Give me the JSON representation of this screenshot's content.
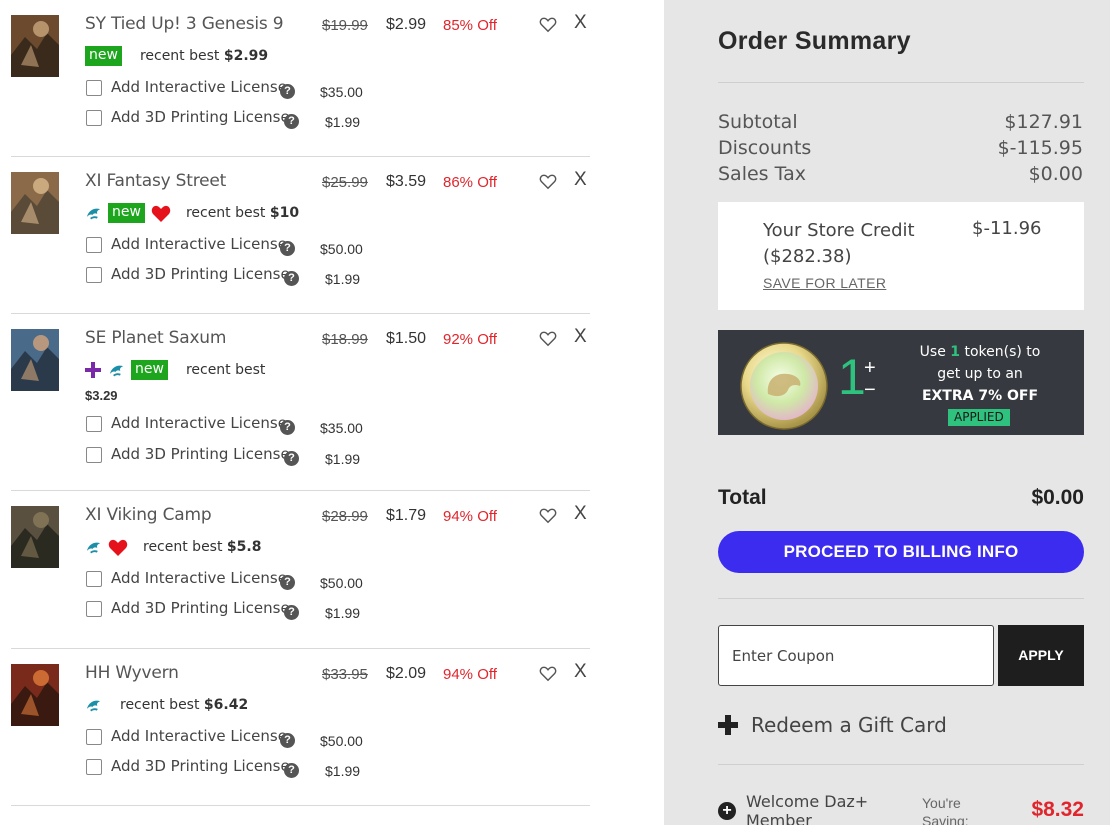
{
  "items": [
    {
      "name": "SY Tied Up! 3 Genesis 9",
      "old_price": "$19.99",
      "new_price": "$2.99",
      "discount": "85% Off",
      "badges": [
        "new"
      ],
      "recent_label": "recent best",
      "recent_value": "$2.99",
      "licenses": [
        {
          "label": "Add Interactive License",
          "price": "$35.00"
        },
        {
          "label": "Add 3D Printing License",
          "price": "$1.99"
        }
      ]
    },
    {
      "name": "XI Fantasy Street",
      "old_price": "$25.99",
      "new_price": "$3.59",
      "discount": "86% Off",
      "badges": [
        "dolphin-icon",
        "new",
        "heart-icon"
      ],
      "recent_label": "recent best",
      "recent_value": "$10",
      "licenses": [
        {
          "label": "Add Interactive License",
          "price": "$50.00"
        },
        {
          "label": "Add 3D Printing License",
          "price": "$1.99"
        }
      ]
    },
    {
      "name": "SE Planet Saxum",
      "old_price": "$18.99",
      "new_price": "$1.50",
      "discount": "92% Off",
      "badges": [
        "plus-icon",
        "dolphin-icon",
        "new"
      ],
      "recent_label": "recent best",
      "recent_value": "$3.29",
      "licenses": [
        {
          "label": "Add Interactive License",
          "price": "$35.00"
        },
        {
          "label": "Add 3D Printing License",
          "price": "$1.99"
        }
      ]
    },
    {
      "name": "XI Viking Camp",
      "old_price": "$28.99",
      "new_price": "$1.79",
      "discount": "94% Off",
      "badges": [
        "dolphin-icon",
        "heart-icon"
      ],
      "recent_label": "recent best",
      "recent_value": "$5.8",
      "licenses": [
        {
          "label": "Add Interactive License",
          "price": "$50.00"
        },
        {
          "label": "Add 3D Printing License",
          "price": "$1.99"
        }
      ]
    },
    {
      "name": "HH Wyvern",
      "old_price": "$33.95",
      "new_price": "$2.09",
      "discount": "94% Off",
      "badges": [
        "dolphin-icon"
      ],
      "recent_label": "recent best",
      "recent_value": "$6.42",
      "licenses": [
        {
          "label": "Add Interactive License",
          "price": "$50.00"
        },
        {
          "label": "Add 3D Printing License",
          "price": "$1.99"
        }
      ]
    }
  ],
  "remove_label": "X",
  "help_label": "?",
  "summary": {
    "title": "Order Summary",
    "subtotal_label": "Subtotal",
    "subtotal_value": "$127.91",
    "discounts_label": "Discounts",
    "discounts_value": "$-115.95",
    "tax_label": "Sales Tax",
    "tax_value": "$0.00",
    "credit_label": "Your Store Credit ($282.38)",
    "credit_value": "$-11.96",
    "save_later": "SAVE FOR LATER",
    "token_count": "1",
    "token_plus": "+",
    "token_minus": "−",
    "token_text_pre": "Use",
    "token_text_num": "1",
    "token_text_post": "token(s) to get up to an",
    "token_extra": "EXTRA 7% OFF",
    "token_applied": "APPLIED",
    "total_label": "Total",
    "total_value": "$0.00",
    "proceed_label": "PROCEED TO BILLING INFO",
    "coupon_placeholder": "Enter Coupon",
    "apply_label": "APPLY",
    "gift_label": "Redeem a Gift Card",
    "member_label": "Welcome Daz+ Member",
    "saving_label": "You're Saving:",
    "saving_value": "$8.32"
  },
  "colors": {
    "accent_green": "#1ea51e",
    "discount_red": "#e0262c",
    "proceed_blue": "#3b2cf0",
    "token_green": "#2ec27e",
    "summary_bg": "#e6e6e6"
  }
}
